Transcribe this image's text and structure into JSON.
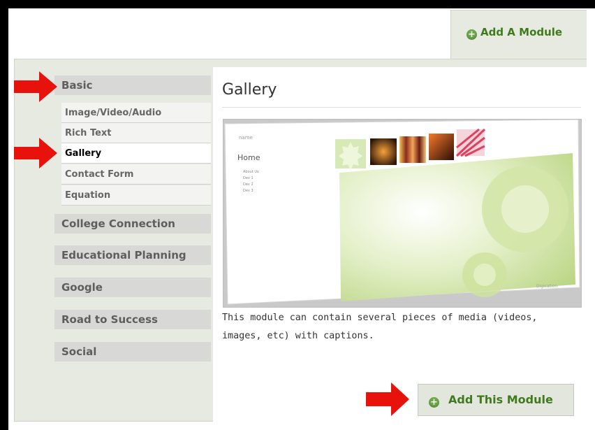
{
  "tab": {
    "label": "Add A Module"
  },
  "sidebar": {
    "basic": {
      "label": "Basic",
      "items": [
        {
          "label": "Image/Video/Audio"
        },
        {
          "label": "Rich Text"
        },
        {
          "label": "Gallery"
        },
        {
          "label": "Contact Form"
        },
        {
          "label": "Equation"
        }
      ]
    },
    "categories": [
      {
        "label": "College Connection"
      },
      {
        "label": "Educational Planning"
      },
      {
        "label": "Google"
      },
      {
        "label": "Road to Success"
      },
      {
        "label": "Social"
      }
    ]
  },
  "main": {
    "title": "Gallery",
    "description": "This module can contain several pieces of media (videos, images, etc) with captions.",
    "preview": {
      "header": "name",
      "heading": "Home",
      "links": [
        "About Us",
        "Dev 1",
        "Dev 2",
        "Dev 3"
      ],
      "brand": "Digication"
    },
    "add_button": "Add This Module"
  },
  "colors": {
    "accent": "#3f7b1c",
    "arrow": "#e8120c",
    "panel": "#e7eae1"
  }
}
